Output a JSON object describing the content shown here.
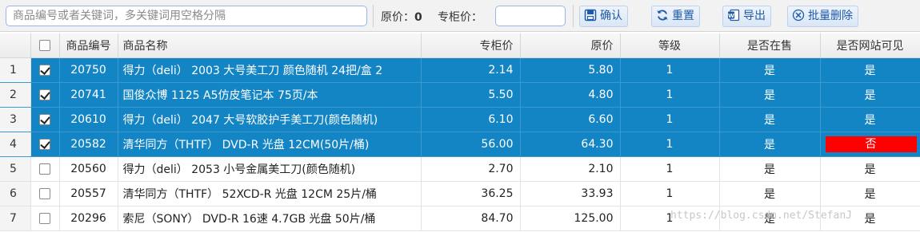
{
  "toolbar": {
    "search_placeholder": "商品编号或者关键词，多关键词用空格分隔",
    "original_price_label": "原价：",
    "original_price_value": "0",
    "counter_price_label": "专柜价：",
    "buttons": [
      {
        "label": "确认",
        "icon": "confirm-icon"
      },
      {
        "label": "重置",
        "icon": "refresh-icon"
      },
      {
        "label": "导出",
        "icon": "export-icon"
      },
      {
        "label": "批量删除",
        "icon": "delete-icon"
      }
    ]
  },
  "grid": {
    "columns": [
      "商品编号",
      "商品名称",
      "专柜价",
      "原价",
      "等级",
      "是否在售",
      "是否网站可见"
    ],
    "rows": [
      {
        "num": "1",
        "checked": true,
        "selected": true,
        "code": "20750",
        "name": "得力（deli） 2003 大号美工刀 颜色随机 24把/盒 2",
        "counter": "2.14",
        "original": "5.80",
        "level": "1",
        "on_sale": "是",
        "visible": "是"
      },
      {
        "num": "2",
        "checked": true,
        "selected": true,
        "code": "20741",
        "name": "国俊众博 1125 A5仿皮笔记本 75页/本",
        "counter": "5.50",
        "original": "4.80",
        "level": "1",
        "on_sale": "是",
        "visible": "是"
      },
      {
        "num": "3",
        "checked": true,
        "selected": true,
        "code": "20610",
        "name": "得力（deli） 2047 大号软胶护手美工刀(颜色随机)",
        "counter": "6.10",
        "original": "6.60",
        "level": "1",
        "on_sale": "是",
        "visible": "是"
      },
      {
        "num": "4",
        "checked": true,
        "selected": true,
        "code": "20582",
        "name": "清华同方（THTF） DVD-R 光盘 12CM(50片/桶)",
        "counter": "56.00",
        "original": "64.30",
        "level": "1",
        "on_sale": "是",
        "visible": "否",
        "visible_flag": true
      },
      {
        "num": "5",
        "checked": false,
        "selected": false,
        "code": "20560",
        "name": "得力（deli） 2053 小号金属美工刀(颜色随机)",
        "counter": "2.70",
        "original": "2.10",
        "level": "1",
        "on_sale": "是",
        "visible": "是"
      },
      {
        "num": "6",
        "checked": false,
        "selected": false,
        "code": "20557",
        "name": "清华同方（THTF） 52XCD-R 光盘 12CM 25片/桶",
        "counter": "36.25",
        "original": "33.93",
        "level": "1",
        "on_sale": "是",
        "visible": "是"
      },
      {
        "num": "7",
        "checked": false,
        "selected": false,
        "code": "20296",
        "name": "索尼（SONY） DVD-R 16速 4.7GB 光盘 50片/桶",
        "counter": "84.70",
        "original": "125.00",
        "level": "1",
        "on_sale": "是",
        "visible": "是"
      }
    ]
  },
  "watermark": "https://blog.csdn.net/StefanJ",
  "colors": {
    "selected_row": "#1485c4",
    "flag_red": "#ff0000",
    "button_text": "#1e5aa8"
  }
}
